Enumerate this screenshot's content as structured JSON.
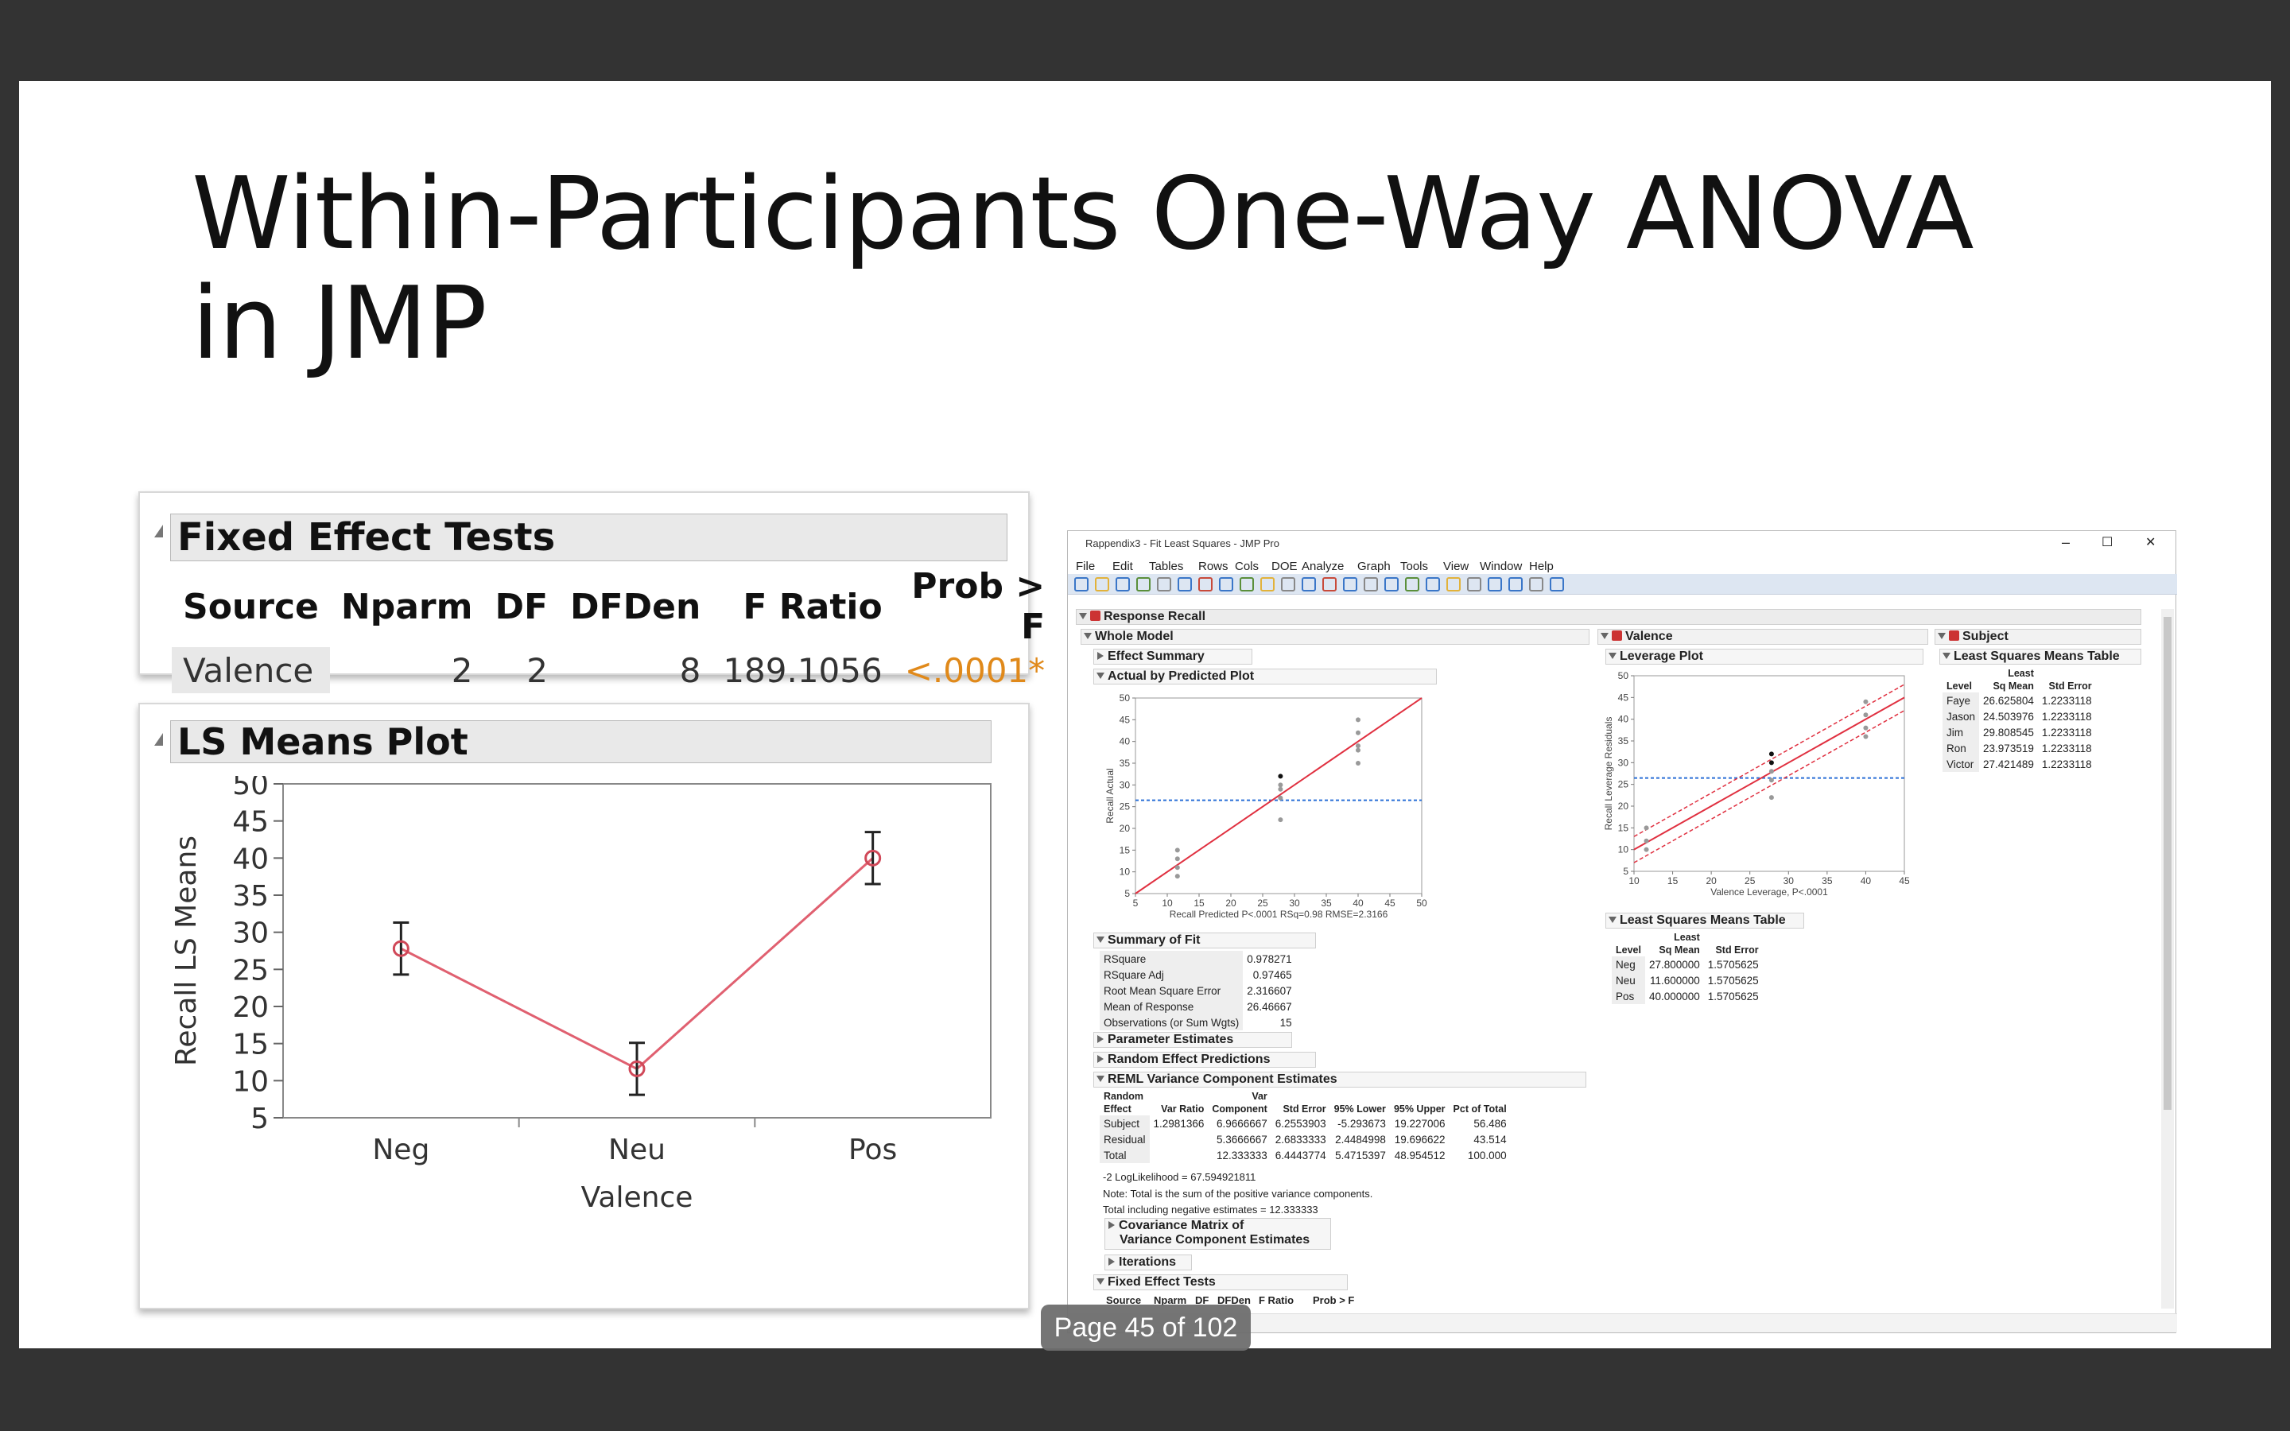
{
  "slide": {
    "title": "Within-Participants One-Way ANOVA\nin JMP",
    "page_indicator": "Page 45 of 102"
  },
  "fixed_effect_panel": {
    "header": "Fixed Effect Tests",
    "columns": [
      "Source",
      "Nparm",
      "DF",
      "DFDen",
      "F Ratio",
      "Prob > F"
    ],
    "row": {
      "source": "Valence",
      "nparm": "2",
      "df": "2",
      "dfden": "8",
      "fratio": "189.1056",
      "prob": "<.0001*"
    },
    "prob_color": "#e0891a"
  },
  "ls_means_panel": {
    "header": "LS Means Plot",
    "chart_data": {
      "type": "line",
      "categories": [
        "Neg",
        "Neu",
        "Pos"
      ],
      "values": [
        27.8,
        11.6,
        40.0
      ],
      "error_low": [
        24.3,
        8.1,
        36.5
      ],
      "error_high": [
        31.3,
        15.1,
        43.5
      ],
      "xlabel": "Valence",
      "ylabel": "Recall LS Means",
      "ylim": [
        5,
        50
      ],
      "yticks": [
        "5",
        "10",
        "15",
        "20",
        "25",
        "30",
        "35",
        "40",
        "45",
        "50"
      ],
      "line_color": "#e06070",
      "grid": false
    }
  },
  "jmp": {
    "window_title": "Rappendix3 - Fit Least Squares - JMP Pro",
    "window_controls": [
      "–",
      "☐",
      "✕"
    ],
    "menu": [
      "File",
      "Edit",
      "Tables",
      "Rows",
      "Cols",
      "DOE",
      "Analyze",
      "Graph",
      "Tools",
      "View",
      "Window",
      "Help"
    ],
    "response": "Response Recall",
    "whole_model": "Whole Model",
    "effect_summary": "Effect Summary",
    "actual_plot": {
      "title": "Actual by Predicted Plot",
      "ylabel": "Recall Actual",
      "xlabel": "Recall Predicted P<.0001 RSq=0.98 RMSE=2.3166",
      "xticks": [
        "5",
        "10",
        "15",
        "20",
        "25",
        "30",
        "35",
        "40",
        "45",
        "50"
      ],
      "yticks": [
        "5",
        "10",
        "15",
        "20",
        "25",
        "30",
        "35",
        "40",
        "45",
        "50"
      ],
      "chart_data": {
        "type": "scatter",
        "xlim": [
          5,
          50
        ],
        "ylim": [
          5,
          50
        ],
        "points": [
          [
            11.6,
            15
          ],
          [
            11.6,
            13
          ],
          [
            11.6,
            11
          ],
          [
            11.6,
            9
          ],
          [
            27.8,
            32
          ],
          [
            27.8,
            30
          ],
          [
            27.8,
            29
          ],
          [
            27.8,
            27
          ],
          [
            27.8,
            22
          ],
          [
            40,
            45
          ],
          [
            40,
            42
          ],
          [
            40,
            39
          ],
          [
            40,
            35
          ],
          [
            40,
            38
          ]
        ],
        "fit": [
          [
            5,
            5
          ],
          [
            50,
            50
          ]
        ],
        "mean": 26.47
      }
    },
    "summary_of_fit": {
      "title": "Summary of Fit",
      "rows": [
        [
          "RSquare",
          "0.978271"
        ],
        [
          "RSquare Adj",
          "0.97465"
        ],
        [
          "Root Mean Square Error",
          "2.316607"
        ],
        [
          "Mean of Response",
          "26.46667"
        ],
        [
          "Observations (or Sum Wgts)",
          "15"
        ]
      ]
    },
    "parameter_estimates": "Parameter Estimates",
    "random_effect_predictions": "Random Effect Predictions",
    "reml": {
      "title": "REML Variance Component Estimates",
      "head1": [
        "Random",
        "",
        "Var",
        "",
        "",
        "",
        "",
        ""
      ],
      "head2": [
        "Effect",
        "Var Ratio",
        "Component",
        "Std Error",
        "95% Lower",
        "95% Upper",
        "Pct of Total"
      ],
      "rows": [
        [
          "Subject",
          "1.2981366",
          "6.9666667",
          "6.2553903",
          "-5.293673",
          "19.227006",
          "56.486"
        ],
        [
          "Residual",
          "",
          "5.3666667",
          "2.6833333",
          "2.4484998",
          "19.696622",
          "43.514"
        ],
        [
          "Total",
          "",
          "12.333333",
          "6.4443774",
          "5.4715397",
          "48.954512",
          "100.000"
        ]
      ],
      "loglik": "-2 LogLikelihood = 67.594921811",
      "note1": "Note: Total is the sum of the positive variance components.",
      "note2": "Total including negative estimates = 12.333333"
    },
    "covariance": [
      "Covariance Matrix of",
      "Variance Component Estimates"
    ],
    "iterations": "Iterations",
    "fixed_effect_tests": {
      "title": "Fixed Effect Tests",
      "cols": [
        "Source",
        "Nparm",
        "DF",
        "DFDen",
        "F Ratio",
        "Prob > F"
      ]
    },
    "valence": {
      "title": "Valence",
      "leverage_plot": "Leverage Plot",
      "ylabel": "Recall Leverage Residuals",
      "xlabel": "Valence Leverage, P<.0001",
      "xticks": [
        "10",
        "15",
        "20",
        "25",
        "30",
        "35",
        "40",
        "45"
      ],
      "yticks": [
        "5",
        "10",
        "15",
        "20",
        "25",
        "30",
        "35",
        "40",
        "45",
        "50"
      ],
      "chart_data": {
        "type": "scatter",
        "xlim": [
          10,
          45
        ],
        "ylim": [
          5,
          50
        ],
        "points": [
          [
            11.6,
            15
          ],
          [
            11.6,
            12
          ],
          [
            11.6,
            10
          ],
          [
            27.8,
            32
          ],
          [
            27.8,
            30
          ],
          [
            27.8,
            28
          ],
          [
            27.8,
            26
          ],
          [
            27.8,
            22
          ],
          [
            40,
            44
          ],
          [
            40,
            41
          ],
          [
            40,
            38
          ],
          [
            40,
            36
          ]
        ],
        "fit": [
          [
            10,
            10
          ],
          [
            45,
            45
          ]
        ],
        "mean": 26.47
      },
      "lsm_title": "Least Squares Means Table",
      "lsm_head1": [
        "",
        "Least",
        ""
      ],
      "lsm_head2": [
        "Level",
        "Sq Mean",
        "Std Error"
      ],
      "lsm_rows": [
        [
          "Neg",
          "27.800000",
          "1.5705625"
        ],
        [
          "Neu",
          "11.600000",
          "1.5705625"
        ],
        [
          "Pos",
          "40.000000",
          "1.5705625"
        ]
      ]
    },
    "subject": {
      "title": "Subject",
      "lsm_title": "Least Squares Means Table",
      "head1": [
        "",
        "Least",
        ""
      ],
      "head2": [
        "Level",
        "Sq Mean",
        "Std Error"
      ],
      "rows": [
        [
          "Faye",
          "26.625804",
          "1.2233118"
        ],
        [
          "Jason",
          "24.503976",
          "1.2233118"
        ],
        [
          "Jim",
          "29.808545",
          "1.2233118"
        ],
        [
          "Ron",
          "23.973519",
          "1.2233118"
        ],
        [
          "Victor",
          "27.421489",
          "1.2233118"
        ]
      ]
    }
  }
}
